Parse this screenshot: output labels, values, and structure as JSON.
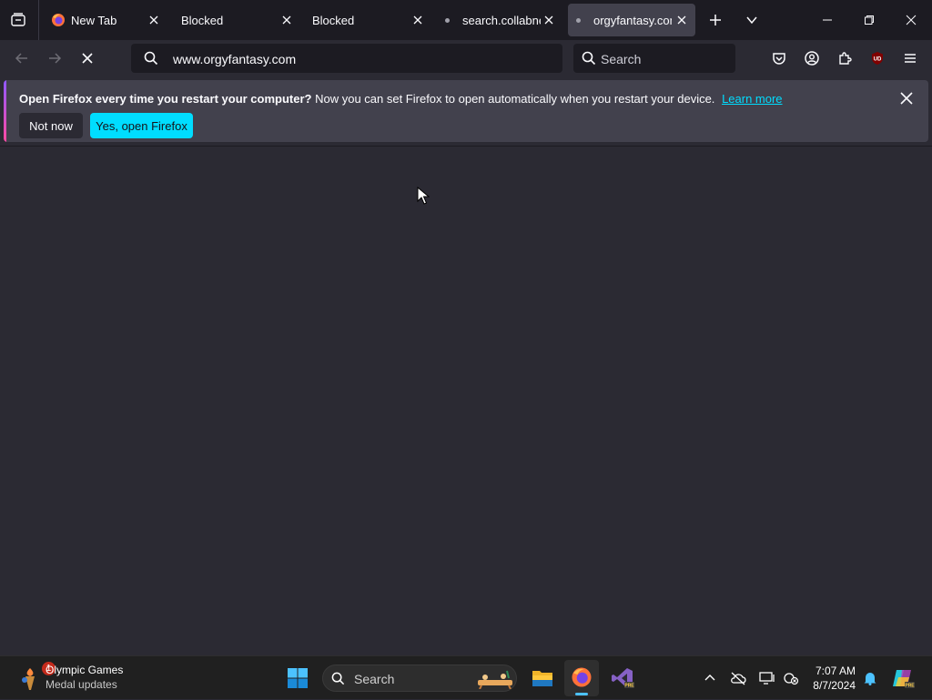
{
  "tabs": [
    {
      "label": "New Tab",
      "active": false,
      "favicon": "firefox-icon"
    },
    {
      "label": "Blocked",
      "active": false,
      "favicon": "none"
    },
    {
      "label": "Blocked",
      "active": false,
      "favicon": "none"
    },
    {
      "label": "search.collabnet",
      "active": false,
      "favicon": "loading-dot"
    },
    {
      "label": "orgyfantasy.com",
      "active": true,
      "favicon": "loading-dot"
    }
  ],
  "urlbar": {
    "url": "www.orgyfantasy.com"
  },
  "searchbar": {
    "placeholder": "Search"
  },
  "notification": {
    "bold": "Open Firefox every time you restart your computer?",
    "text": " Now you can set Firefox to open automatically when you restart your device.",
    "link": "Learn more",
    "not_now": "Not now",
    "yes": "Yes, open Firefox"
  },
  "taskbar": {
    "news_badge": "1",
    "news_title": "Olympic Games",
    "news_subtitle": "Medal updates",
    "search_placeholder": "Search",
    "time": "7:07 AM",
    "date": "8/7/2024"
  },
  "colors": {
    "accent": "#00ddff",
    "toolbar": "#2b2a33",
    "tabstrip": "#1c1b22"
  }
}
